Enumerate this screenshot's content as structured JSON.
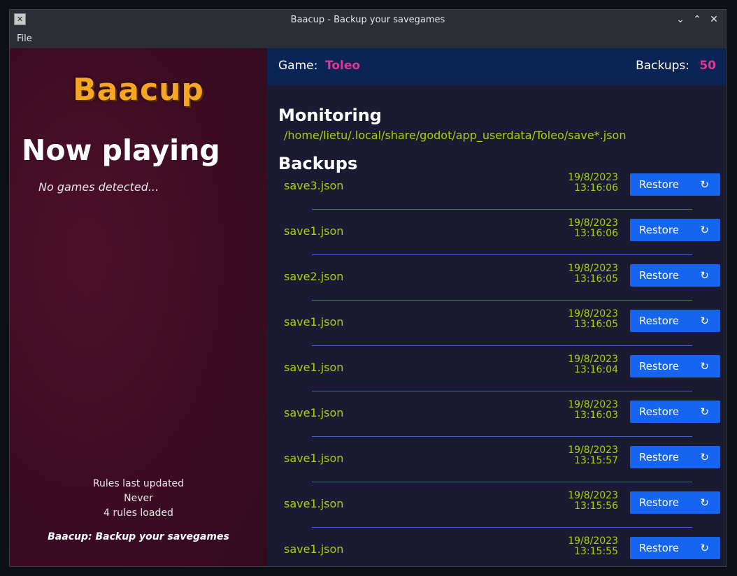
{
  "window": {
    "title": "Baacup - Backup your savegames"
  },
  "menu": {
    "file": "File"
  },
  "left": {
    "logo": "Baacup",
    "now_playing": "Now playing",
    "no_games": "No games detected...",
    "rules_label": "Rules last updated",
    "rules_updated": "Never",
    "rules_count": "4 rules loaded",
    "tagline": "Baacup: Backup your savegames"
  },
  "header": {
    "game_label": "Game:",
    "game": "Toleo",
    "backups_label": "Backups:",
    "backups_count": "50"
  },
  "monitoring": {
    "title": "Monitoring",
    "path": "/home/lietu/.local/share/godot/app_userdata/Toleo/save*.json"
  },
  "backups": {
    "title": "Backups",
    "restore_label": "Restore",
    "items": [
      {
        "file": "save3.json",
        "date": "19/8/2023",
        "time": "13:16:06"
      },
      {
        "file": "save1.json",
        "date": "19/8/2023",
        "time": "13:16:06"
      },
      {
        "file": "save2.json",
        "date": "19/8/2023",
        "time": "13:16:05"
      },
      {
        "file": "save1.json",
        "date": "19/8/2023",
        "time": "13:16:05"
      },
      {
        "file": "save1.json",
        "date": "19/8/2023",
        "time": "13:16:04"
      },
      {
        "file": "save1.json",
        "date": "19/8/2023",
        "time": "13:16:03"
      },
      {
        "file": "save1.json",
        "date": "19/8/2023",
        "time": "13:15:57"
      },
      {
        "file": "save1.json",
        "date": "19/8/2023",
        "time": "13:15:56"
      },
      {
        "file": "save1.json",
        "date": "19/8/2023",
        "time": "13:15:55"
      }
    ]
  },
  "colors": {
    "accent_pink": "#e0368f",
    "path_green": "#a8d400",
    "button_blue": "#1565f0",
    "logo_orange": "#f5a623"
  }
}
